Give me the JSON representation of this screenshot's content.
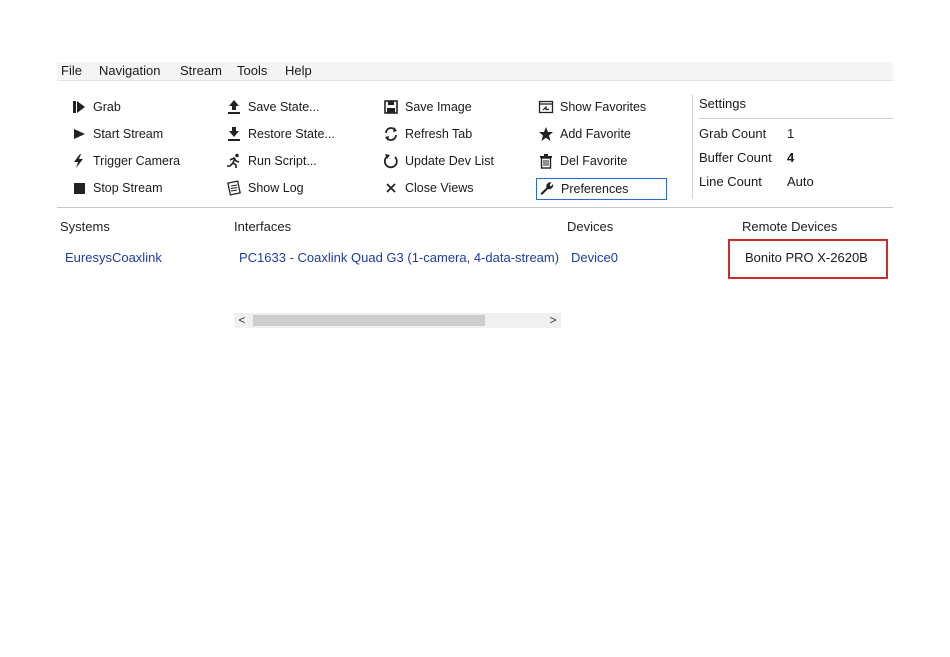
{
  "menu": [
    "File",
    "Navigation",
    "Stream",
    "Tools",
    "Help"
  ],
  "toolbar": {
    "col1": [
      {
        "label": "Grab",
        "icon": "grab-icon"
      },
      {
        "label": "Start Stream",
        "icon": "play-icon"
      },
      {
        "label": "Trigger Camera",
        "icon": "lightning-icon"
      },
      {
        "label": "Stop Stream",
        "icon": "stop-icon"
      }
    ],
    "col2": [
      {
        "label": "Save State...",
        "icon": "upload-icon"
      },
      {
        "label": "Restore State...",
        "icon": "download-icon"
      },
      {
        "label": "Run Script...",
        "icon": "run-icon"
      },
      {
        "label": "Show Log",
        "icon": "log-icon"
      }
    ],
    "col3": [
      {
        "label": "Save Image",
        "icon": "floppy-icon"
      },
      {
        "label": "Refresh Tab",
        "icon": "refresh-icon"
      },
      {
        "label": "Update Dev List",
        "icon": "update-icon"
      },
      {
        "label": "Close Views",
        "icon": "close-icon"
      }
    ],
    "col4": [
      {
        "label": "Show Favorites",
        "icon": "favorites-window-icon"
      },
      {
        "label": "Add Favorite",
        "icon": "star-icon"
      },
      {
        "label": "Del Favorite",
        "icon": "trash-icon"
      },
      {
        "label": "Preferences",
        "icon": "wrench-icon"
      }
    ]
  },
  "settings": {
    "title": "Settings",
    "rows": [
      {
        "label": "Grab Count",
        "value": "1"
      },
      {
        "label": "Buffer Count",
        "value": "4"
      },
      {
        "label": "Line Count",
        "value": "Auto"
      }
    ]
  },
  "tree": {
    "headers": [
      "Systems",
      "Interfaces",
      "Devices",
      "Remote Devices"
    ],
    "system": "EuresysCoaxlink",
    "interface": "PC1633 - Coaxlink Quad G3 (1-camera, 4-data-stream)",
    "device": "Device0",
    "remote_device": "Bonito PRO X-2620B"
  },
  "scrollbar": {
    "left": "<",
    "right": ">"
  },
  "colors": {
    "link": "#1f3aa6",
    "highlight_border": "#cc2b2b",
    "focus_border": "#2b6cd4"
  }
}
